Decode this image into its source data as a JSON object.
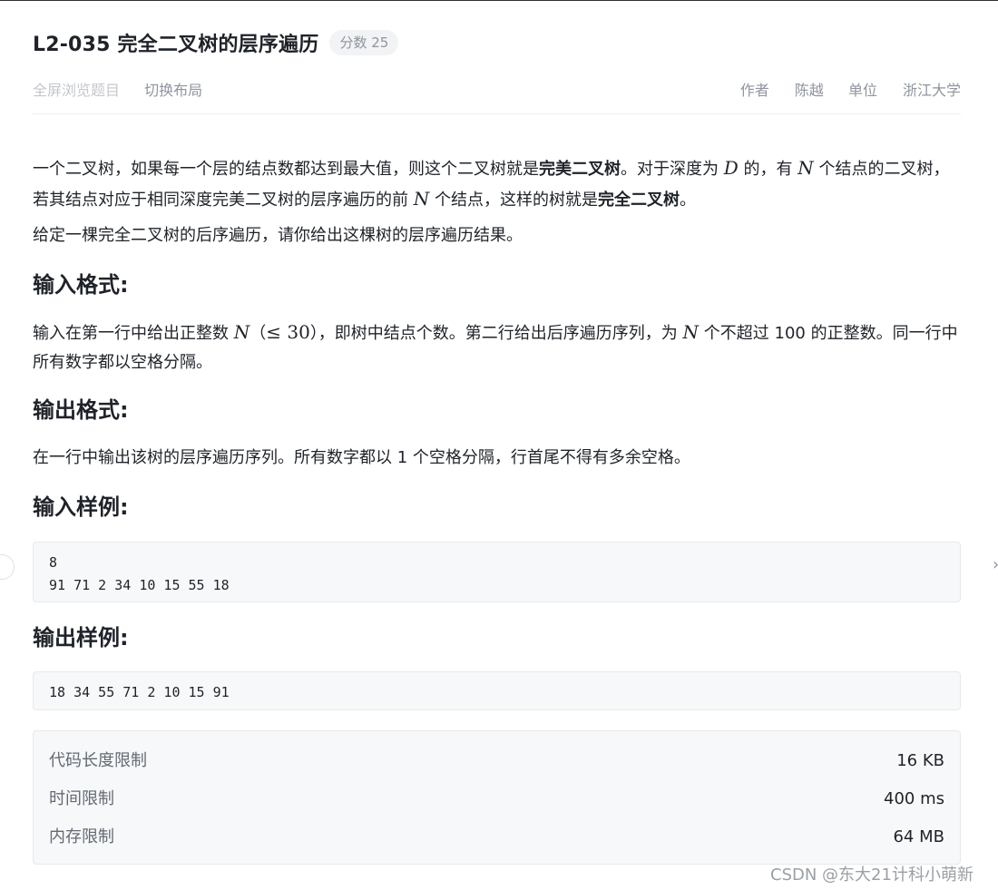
{
  "problem": {
    "title": "L2-035 完全二叉树的层序遍历",
    "score_label": "分数 25"
  },
  "meta": {
    "fullscreen_label": "全屏浏览题目",
    "switch_layout_label": "切换布局",
    "author_label": "作者",
    "author_value": "陈越",
    "unit_label": "单位",
    "unit_value": "浙江大学"
  },
  "desc": {
    "p1_a": "一个二叉树，如果每一个层的结点数都达到最大值，则这个二叉树就是",
    "p1_bold1": "完美二叉树",
    "p1_b": "。对于深度为 ",
    "p1_math_D": "D",
    "p1_c": " 的，有 ",
    "p1_math_N1": "N",
    "p1_d": " 个结点的二叉树，若其结点对应于相同深度完美二叉树的层序遍历的前 ",
    "p1_math_N2": "N",
    "p1_e": " 个结点，这样的树就是",
    "p1_bold2": "完全二叉树",
    "p1_f": "。",
    "p2": "给定一棵完全二叉树的后序遍历，请你给出这棵树的层序遍历结果。"
  },
  "input_format": {
    "heading": "输入格式:",
    "a": "输入在第一行中给出正整数 ",
    "math_N": "N",
    "b": "（",
    "math_le": "≤ 30",
    "c": "），即树中结点个数。第二行给出后序遍历序列，为 ",
    "math_N2": "N",
    "d": " 个不超过 100 的正整数。同一行中所有数字都以空格分隔。"
  },
  "output_format": {
    "heading": "输出格式:",
    "text": "在一行中输出该树的层序遍历序列。所有数字都以 1 个空格分隔，行首尾不得有多余空格。"
  },
  "sample_input": {
    "heading": "输入样例:",
    "line1": "8",
    "line2": "91 71 2 34 10 15 55 18"
  },
  "sample_output": {
    "heading": "输出样例:",
    "line1": "18 34 55 71 2 10 15 91"
  },
  "limits": [
    {
      "label": "代码长度限制",
      "value": "16 KB"
    },
    {
      "label": "时间限制",
      "value": "400 ms"
    },
    {
      "label": "内存限制",
      "value": "64 MB"
    }
  ],
  "watermark": "CSDN @东大21计科小萌新"
}
